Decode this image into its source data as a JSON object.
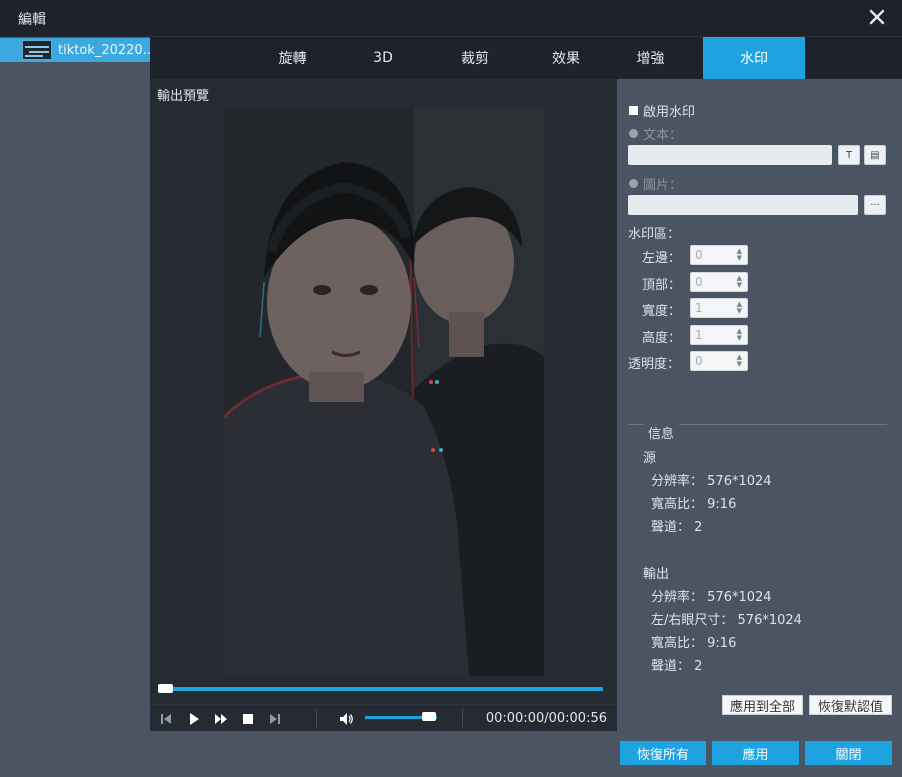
{
  "window": {
    "title": "編輯",
    "close_icon": "close-icon"
  },
  "sidebar": {
    "file_name": "tiktok_20220...",
    "thumb_icon": "video-thumbnail"
  },
  "tabs": [
    {
      "label": "旋轉"
    },
    {
      "label": "3D"
    },
    {
      "label": "裁剪"
    },
    {
      "label": "效果"
    },
    {
      "label": "增強"
    },
    {
      "label": "水印",
      "active": true
    }
  ],
  "preview": {
    "label": "輸出預覽",
    "timecode": "00:00:00/00:00:56",
    "progress": 0,
    "volume": 0.8
  },
  "watermark": {
    "enable_label": "啟用水印",
    "enabled": false,
    "text_label": "文本：",
    "text_value": "",
    "text_btn_icon": "text-icon",
    "text_style_icon": "font-settings-icon",
    "image_label": "圖片：",
    "image_value": "",
    "browse_label": "···",
    "area_label": "水印區：",
    "left_label": "左邊：",
    "left_value": "0",
    "top_label": "頂部：",
    "top_value": "0",
    "width_label": "寬度：",
    "width_value": "1",
    "height_label": "高度：",
    "height_value": "1",
    "opacity_label": "透明度：",
    "opacity_value": "0"
  },
  "info": {
    "title": "信息",
    "source_title": "源",
    "src_res_label": "分辨率：",
    "src_res": "576*1024",
    "src_ratio_label": "寬高比：",
    "src_ratio": "9:16",
    "src_ch_label": "聲道：",
    "src_ch": "2",
    "output_title": "輸出",
    "out_res_label": "分辨率：",
    "out_res": "576*1024",
    "out_eye_label": "左/右眼尺寸：",
    "out_eye": "576*1024",
    "out_ratio_label": "寬高比：",
    "out_ratio": "9:16",
    "out_ch_label": "聲道：",
    "out_ch": "2"
  },
  "panel_buttons": {
    "apply_all": "應用到全部",
    "restore_default": "恢復默認值"
  },
  "footer": {
    "restore_all": "恢復所有",
    "apply": "應用",
    "close": "關閉"
  },
  "colors": {
    "accent": "#1ea3e0",
    "panel": "#4a5463",
    "dark": "#1d222b"
  }
}
